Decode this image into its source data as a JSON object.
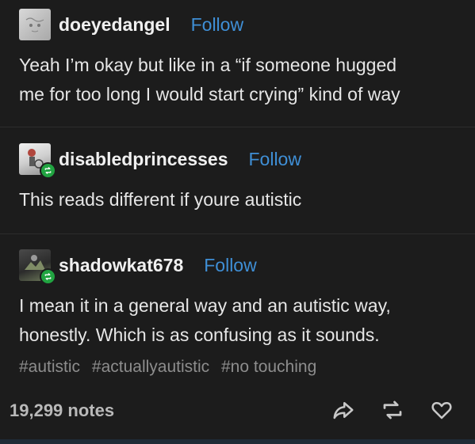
{
  "posts": [
    {
      "username": "doeyedangel",
      "follow_label": "Follow",
      "text_lines": [
        "Yeah I’m okay but like in a “if someone hugged",
        "me for too long I would start crying” kind of way"
      ]
    },
    {
      "username": "disabledprincesses",
      "follow_label": "Follow",
      "text_lines": [
        "This reads different if youre autistic"
      ]
    },
    {
      "username": "shadowkat678",
      "follow_label": "Follow",
      "text_lines": [
        "I mean it in a general way and an autistic way,",
        "honestly. Which is as confusing as it sounds."
      ]
    }
  ],
  "tags": [
    "#autistic",
    "#actuallyautistic",
    "#no touching"
  ],
  "footer": {
    "notes": "19,299 notes",
    "icons": [
      "share-icon",
      "reblog-icon",
      "like-icon"
    ]
  },
  "colors": {
    "background": "#1c1c1c",
    "follow_link": "#3f8fd6",
    "reblog_badge": "#21a441",
    "tag_text": "#8d8d8d"
  }
}
